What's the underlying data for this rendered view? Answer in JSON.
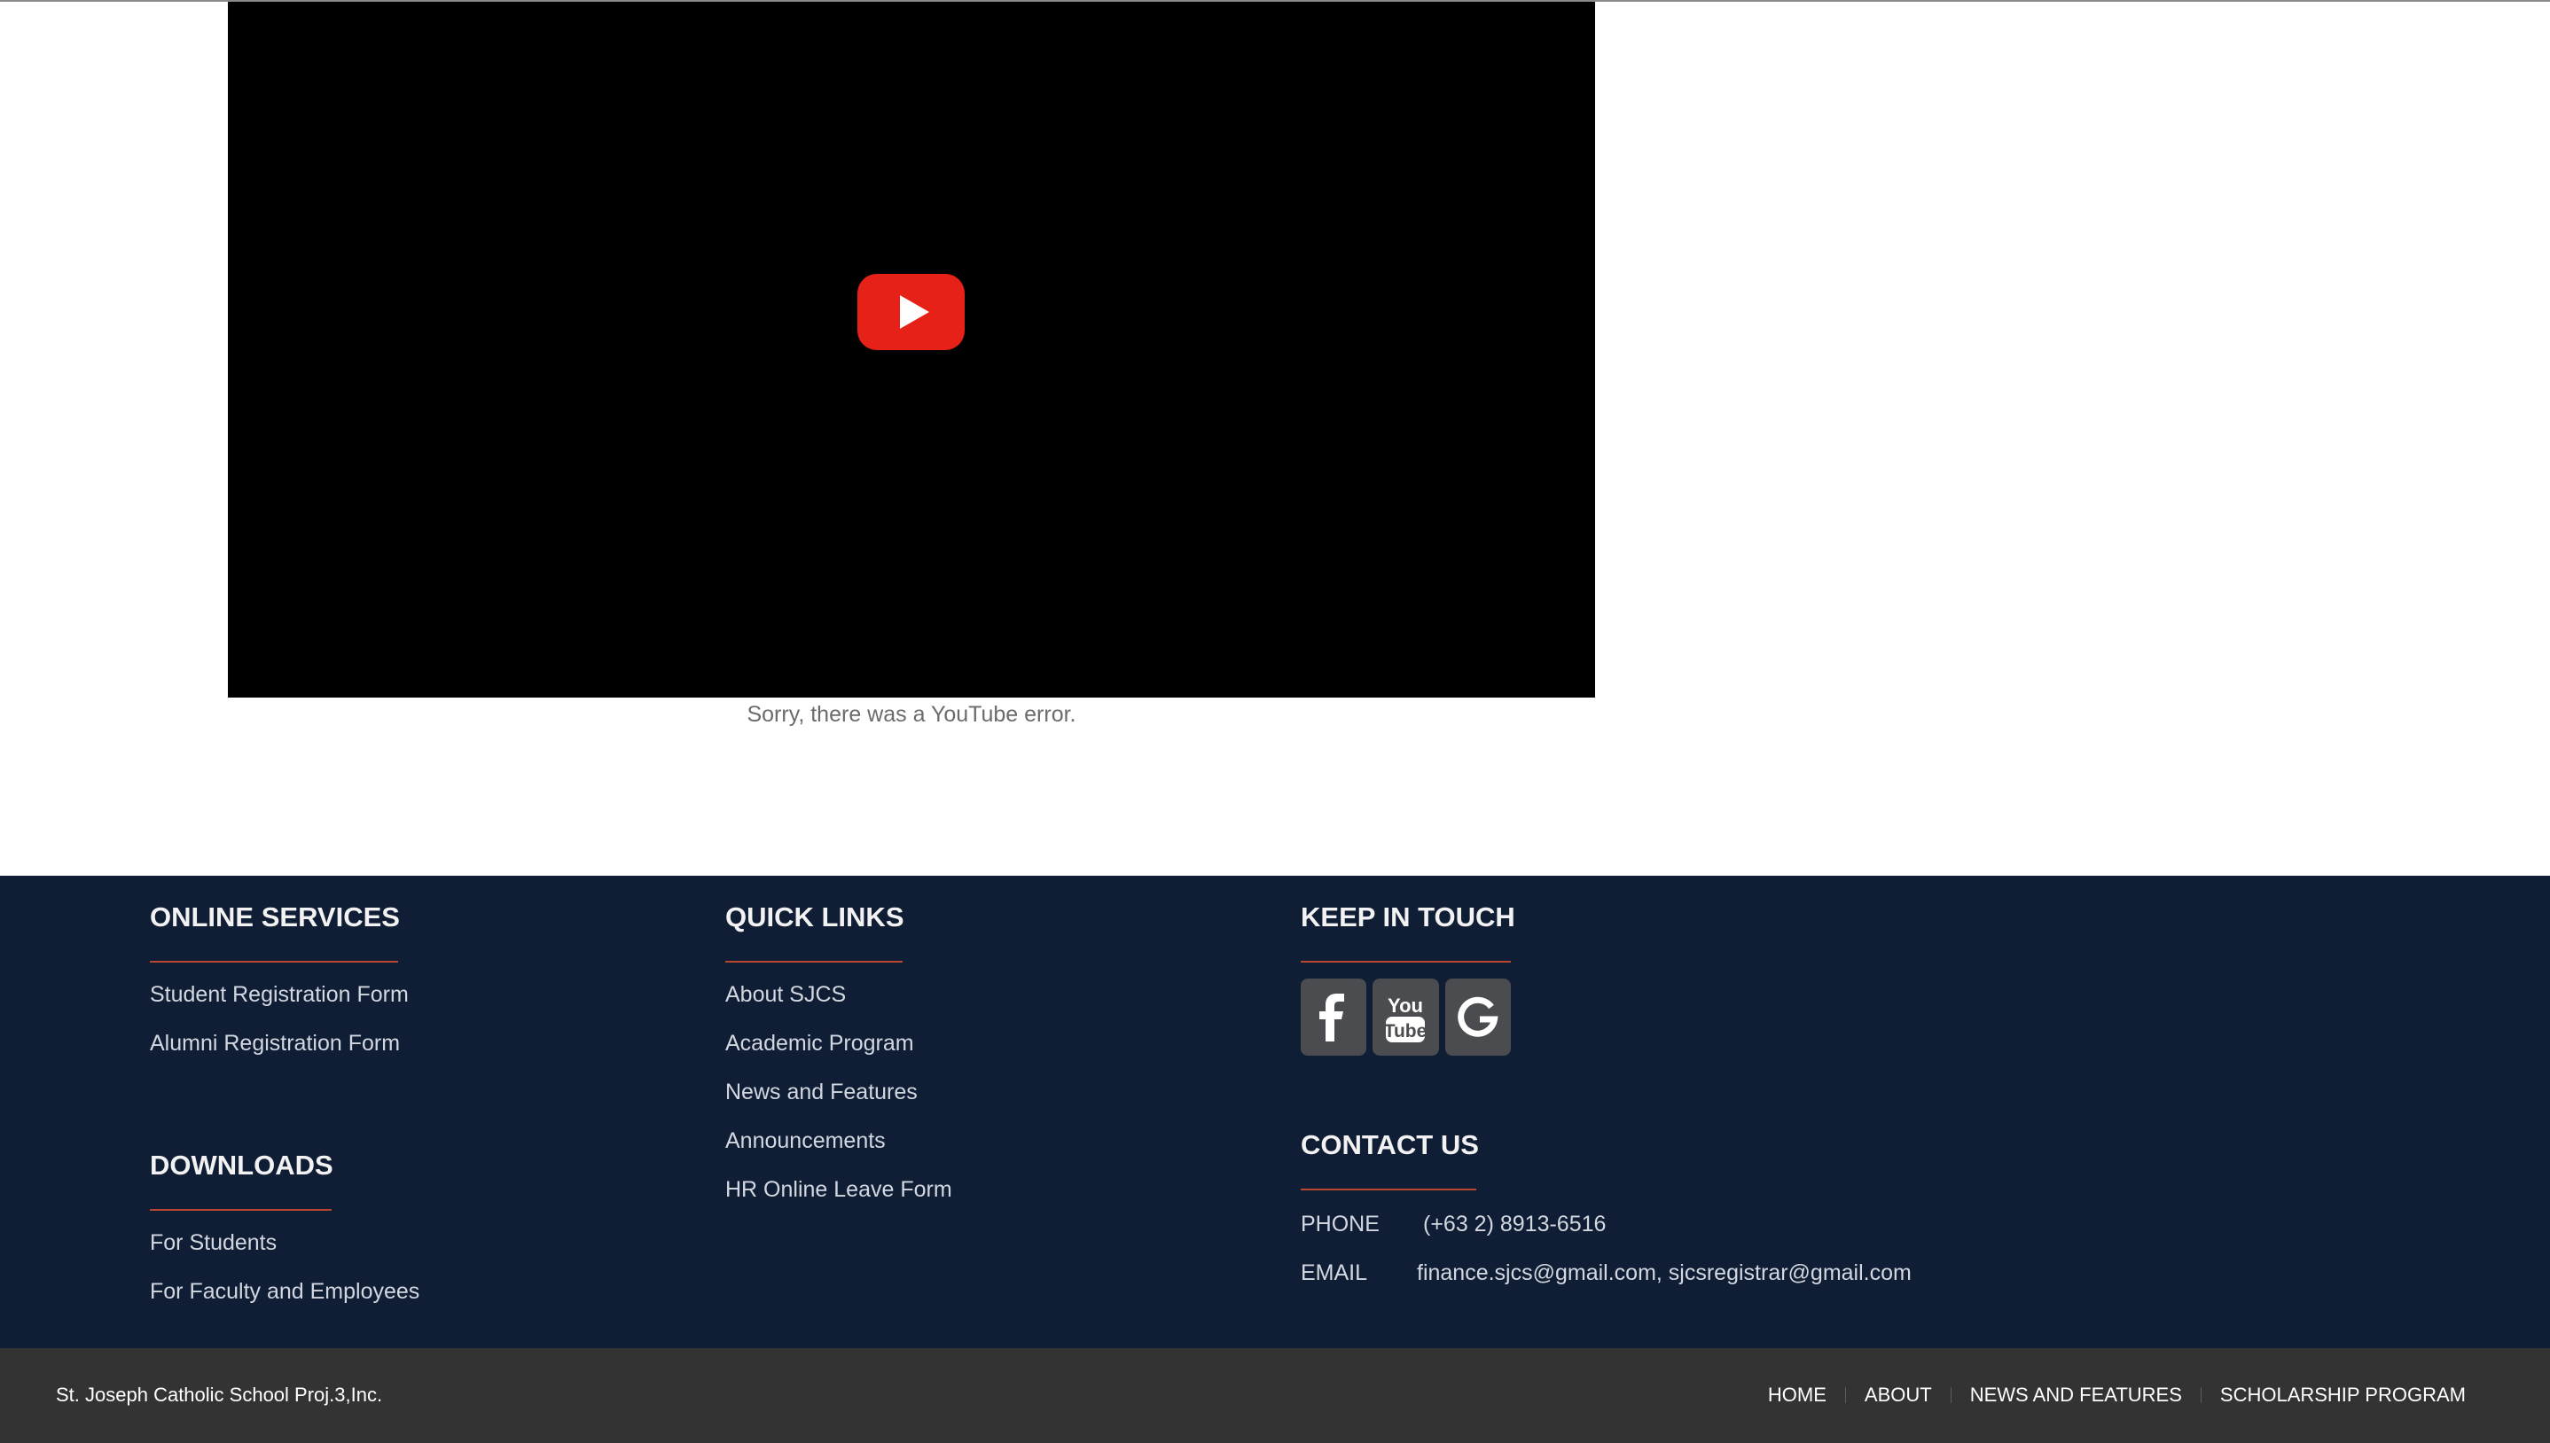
{
  "video": {
    "play_icon": "youtube-play-icon",
    "error_text": "Sorry, there was a YouTube error."
  },
  "footer": {
    "online_services": {
      "heading": "ONLINE SERVICES",
      "links": [
        "Student Registration Form",
        "Alumni Registration Form"
      ]
    },
    "downloads": {
      "heading": "DOWNLOADS",
      "links": [
        "For Students",
        "For Faculty and Employees"
      ]
    },
    "quick_links": {
      "heading": "QUICK LINKS",
      "links": [
        "About SJCS",
        "Academic Program",
        "News and Features",
        "Announcements",
        "HR Online Leave Form"
      ]
    },
    "keep_in_touch": {
      "heading": "KEEP IN TOUCH",
      "icons": [
        "facebook-icon",
        "youtube-icon",
        "google-icon"
      ]
    },
    "contact_us": {
      "heading": "CONTACT US",
      "phone_label": "PHONE",
      "phone_value": "(+63 2) 8913-6516",
      "email_label": "EMAIL",
      "email_value": "finance.sjcs@gmail.com, sjcsregistrar@gmail.com"
    }
  },
  "bottom_bar": {
    "copyright": "St. Joseph Catholic School Proj.3,Inc.",
    "nav": [
      "HOME",
      "ABOUT",
      "NEWS AND FEATURES",
      "SCHOLARSHIP PROGRAM"
    ]
  },
  "colors": {
    "footer_bg": "#0f1d35",
    "bottom_bar_bg": "#333333",
    "accent_rule": "#b8472e",
    "youtube_red": "#e62117"
  }
}
